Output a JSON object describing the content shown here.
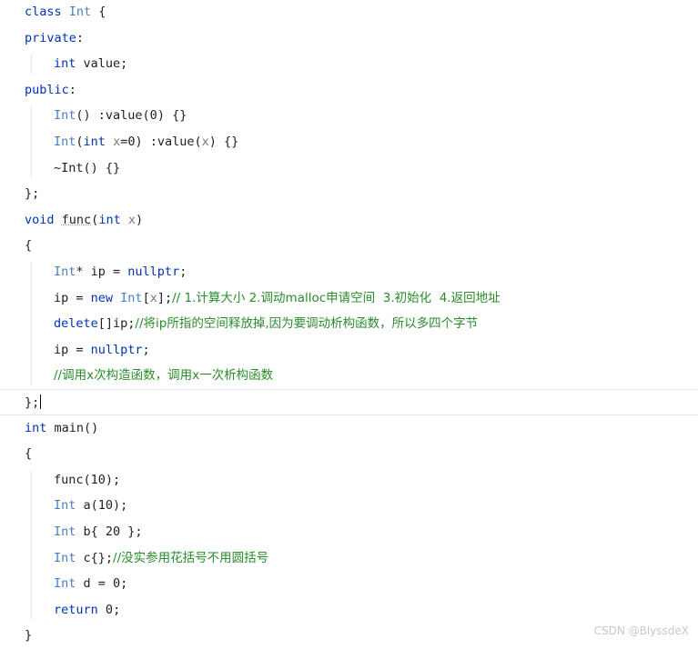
{
  "editor": {
    "lines": [
      {
        "indent": 0,
        "tokens": [
          {
            "t": "class ",
            "c": "kw"
          },
          {
            "t": "Int",
            "c": "type"
          },
          {
            "t": " {",
            "c": "p"
          }
        ]
      },
      {
        "indent": 0,
        "tokens": [
          {
            "t": "private",
            "c": "kw"
          },
          {
            "t": ":",
            "c": "p"
          }
        ]
      },
      {
        "indent": 1,
        "tokens": [
          {
            "t": "int",
            "c": "kw"
          },
          {
            "t": " value;",
            "c": "id"
          }
        ]
      },
      {
        "indent": 0,
        "tokens": [
          {
            "t": "public",
            "c": "kw"
          },
          {
            "t": ":",
            "c": "p"
          }
        ]
      },
      {
        "indent": 1,
        "tokens": [
          {
            "t": "Int",
            "c": "type"
          },
          {
            "t": "() :value(",
            "c": "p"
          },
          {
            "t": "0",
            "c": "id"
          },
          {
            "t": ") {}",
            "c": "p"
          }
        ]
      },
      {
        "indent": 1,
        "tokens": [
          {
            "t": "Int",
            "c": "type"
          },
          {
            "t": "(",
            "c": "p"
          },
          {
            "t": "int",
            "c": "kw"
          },
          {
            "t": " ",
            "c": "p"
          },
          {
            "t": "x",
            "c": "param"
          },
          {
            "t": "=0) :value(",
            "c": "p"
          },
          {
            "t": "x",
            "c": "param"
          },
          {
            "t": ") {}",
            "c": "p"
          }
        ]
      },
      {
        "indent": 1,
        "tokens": [
          {
            "t": "~Int() {}",
            "c": "p"
          }
        ]
      },
      {
        "indent": 0,
        "tokens": [
          {
            "t": "};",
            "c": "p"
          }
        ]
      },
      {
        "indent": 0,
        "tokens": [
          {
            "t": "void",
            "c": "kw"
          },
          {
            "t": " ",
            "c": "p"
          },
          {
            "t": "func",
            "c": "fn",
            "sq": true
          },
          {
            "t": "(",
            "c": "p"
          },
          {
            "t": "int",
            "c": "kw"
          },
          {
            "t": " ",
            "c": "p"
          },
          {
            "t": "x",
            "c": "param"
          },
          {
            "t": ")",
            "c": "p"
          }
        ]
      },
      {
        "indent": 0,
        "tokens": [
          {
            "t": "{",
            "c": "p"
          }
        ]
      },
      {
        "indent": 1,
        "tokens": [
          {
            "t": "Int",
            "c": "type"
          },
          {
            "t": "* ip = ",
            "c": "p"
          },
          {
            "t": "nullptr",
            "c": "kw"
          },
          {
            "t": ";",
            "c": "p"
          }
        ]
      },
      {
        "indent": 1,
        "tokens": [
          {
            "t": "ip = ",
            "c": "p"
          },
          {
            "t": "new",
            "c": "kw"
          },
          {
            "t": " ",
            "c": "p"
          },
          {
            "t": "Int",
            "c": "type"
          },
          {
            "t": "[",
            "c": "p"
          },
          {
            "t": "x",
            "c": "param"
          },
          {
            "t": "];",
            "c": "p"
          },
          {
            "t": "// 1.计算大小 2.调动malloc申请空间  3.初始化  4.返回地址",
            "c": "cm"
          }
        ]
      },
      {
        "indent": 1,
        "tokens": [
          {
            "t": "delete",
            "c": "kw"
          },
          {
            "t": "[]ip;",
            "c": "p"
          },
          {
            "t": "//将ip所指的空间释放掉,因为要调动析构函数，所以多四个字节",
            "c": "cm"
          }
        ]
      },
      {
        "indent": 1,
        "tokens": [
          {
            "t": "ip = ",
            "c": "p"
          },
          {
            "t": "nullptr",
            "c": "kw"
          },
          {
            "t": ";",
            "c": "p"
          }
        ]
      },
      {
        "indent": 1,
        "tokens": [
          {
            "t": "//调用x次构造函数，调用x一次析构函数",
            "c": "cm"
          }
        ]
      },
      {
        "indent": 0,
        "tokens": [
          {
            "t": "};",
            "c": "p"
          }
        ],
        "current": true
      },
      {
        "indent": 0,
        "tokens": [
          {
            "t": "int",
            "c": "kw"
          },
          {
            "t": " main()",
            "c": "p"
          }
        ]
      },
      {
        "indent": 0,
        "tokens": [
          {
            "t": "{",
            "c": "p"
          }
        ]
      },
      {
        "indent": 1,
        "tokens": [
          {
            "t": "func(",
            "c": "p"
          },
          {
            "t": "10",
            "c": "id"
          },
          {
            "t": ");",
            "c": "p"
          }
        ]
      },
      {
        "indent": 1,
        "tokens": [
          {
            "t": "Int",
            "c": "type"
          },
          {
            "t": " a(",
            "c": "p"
          },
          {
            "t": "10",
            "c": "id"
          },
          {
            "t": ");",
            "c": "p"
          }
        ]
      },
      {
        "indent": 1,
        "tokens": [
          {
            "t": "Int",
            "c": "type"
          },
          {
            "t": " b{ ",
            "c": "p"
          },
          {
            "t": "20",
            "c": "id"
          },
          {
            "t": " };",
            "c": "p"
          }
        ]
      },
      {
        "indent": 1,
        "tokens": [
          {
            "t": "Int",
            "c": "type"
          },
          {
            "t": " c{};",
            "c": "p"
          },
          {
            "t": "//没实参用花括号不用圆括号",
            "c": "cm"
          }
        ]
      },
      {
        "indent": 1,
        "tokens": [
          {
            "t": "Int",
            "c": "type"
          },
          {
            "t": " d = ",
            "c": "p"
          },
          {
            "t": "0",
            "c": "id"
          },
          {
            "t": ";",
            "c": "p"
          }
        ]
      },
      {
        "indent": 1,
        "tokens": [
          {
            "t": "return",
            "c": "kw"
          },
          {
            "t": " ",
            "c": "p"
          },
          {
            "t": "0",
            "c": "id"
          },
          {
            "t": ";",
            "c": "p"
          }
        ]
      },
      {
        "indent": 0,
        "tokens": [
          {
            "t": "}",
            "c": "p"
          }
        ]
      }
    ]
  },
  "watermark": "CSDN @BlyssdeX",
  "colors": {
    "keyword": "#0033b3",
    "type": "#4a7fc1",
    "comment": "#2a8c2a",
    "text": "#1f1f1f",
    "background": "#ffffff"
  }
}
